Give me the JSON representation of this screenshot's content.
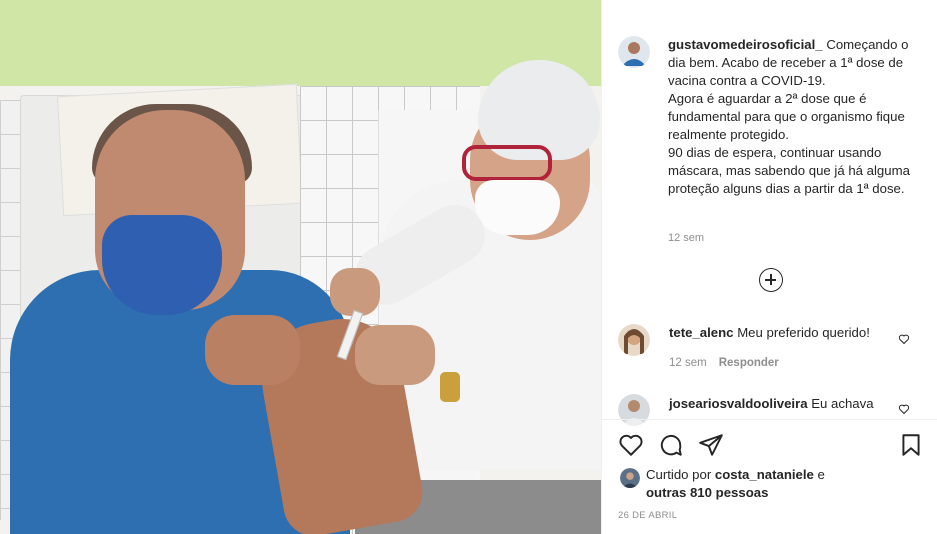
{
  "post": {
    "author": "gustavomedeirosoficial_",
    "caption": "Começando o dia bem. Acabo de receber a 1ª dose de vacina contra a COVID-19.\nAgora é aguardar a 2ª dose que é fundamental para que o organismo fique realmente protegido.\n90 dias de espera, continuar usando máscara, mas sabendo que já há alguma proteção alguns dias a partir da 1ª dose.",
    "caption_time": "12 sem",
    "date": "26 DE ABRIL"
  },
  "comments": [
    {
      "user": "tete_alenc",
      "text": "Meu preferido querido!",
      "time": "12 sem",
      "reply_label": "Responder"
    },
    {
      "user": "joseariosvaldooliveira",
      "text": "Eu achava"
    }
  ],
  "likes": {
    "prefix": "Curtido por",
    "user": "costa_nataniele",
    "connector": "e",
    "others": "outras 810 pessoas"
  },
  "icons": {
    "load_more": "plus-circle-icon",
    "like": "heart-icon",
    "comment": "comment-icon",
    "share": "send-icon",
    "save": "bookmark-icon"
  },
  "colors": {
    "text": "#262626",
    "muted": "#8e8e8e",
    "border": "#efefef"
  }
}
